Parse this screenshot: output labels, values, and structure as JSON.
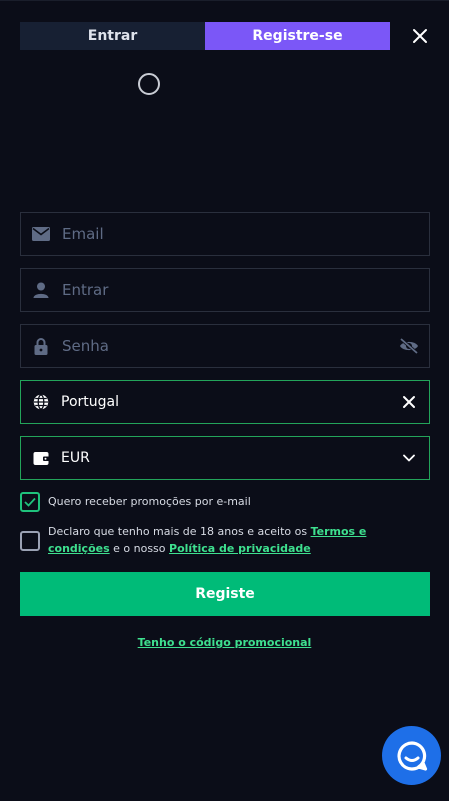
{
  "tabs": {
    "login": "Entrar",
    "register": "Registre-se"
  },
  "form": {
    "email_placeholder": "Email",
    "username_placeholder": "Entrar",
    "password_placeholder": "Senha",
    "country_value": "Portugal",
    "currency_value": "EUR"
  },
  "checks": {
    "promo_email": {
      "label": "Quero receber promoções por e-mail",
      "checked": true
    },
    "terms": {
      "text_before": "Declaro que tenho mais de 18 anos e aceito os ",
      "terms_link": "Termos e condições",
      "text_middle": " e o nosso ",
      "privacy_link": "Política de privacidade",
      "checked": false
    }
  },
  "submit_label": "Registe",
  "promo_code_link": "Tenho o código promocional",
  "colors": {
    "background": "#0b0d18",
    "accent_purple": "#7b57f7",
    "accent_green": "#00bb78",
    "link_green": "#3ee08f",
    "chat_blue": "#1e6fe8"
  },
  "icons": {
    "close": "close-icon",
    "email": "envelope-icon",
    "user": "user-icon",
    "lock": "lock-icon",
    "eye": "eye-off-icon",
    "globe": "globe-icon",
    "wallet": "wallet-icon",
    "chevron": "chevron-down-icon",
    "chat": "chat-icon"
  }
}
